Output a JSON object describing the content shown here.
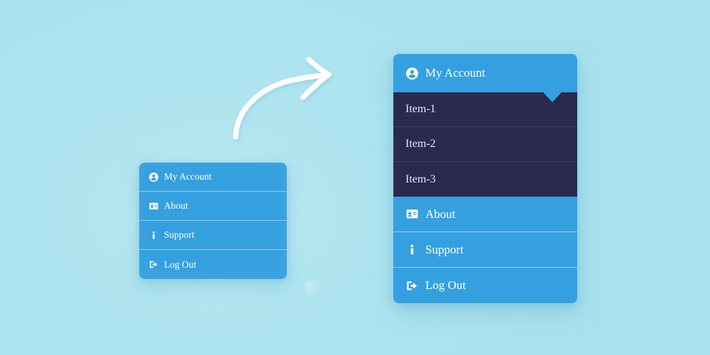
{
  "page": {
    "background_color": "#ade4ef",
    "accent_blue": "#35a0e0",
    "submenu_dark": "#2a2a50",
    "text_color": "#ffffff"
  },
  "arrow": {
    "name": "curved-arrow",
    "direction": "right",
    "color": "#ffffff"
  },
  "small_menu": {
    "items": [
      {
        "label": "My Account",
        "icon": "user-circle-icon"
      },
      {
        "label": "About",
        "icon": "id-card-icon"
      },
      {
        "label": "Support",
        "icon": "info-icon"
      },
      {
        "label": "Log Out",
        "icon": "sign-out-icon"
      }
    ]
  },
  "large_menu": {
    "header": {
      "label": "My Account",
      "icon": "user-circle-icon"
    },
    "submenu": [
      {
        "label": "Item-1"
      },
      {
        "label": "Item-2"
      },
      {
        "label": "Item-3"
      }
    ],
    "items": [
      {
        "label": "About",
        "icon": "id-card-icon"
      },
      {
        "label": "Support",
        "icon": "info-icon"
      },
      {
        "label": "Log Out",
        "icon": "sign-out-icon"
      }
    ]
  }
}
